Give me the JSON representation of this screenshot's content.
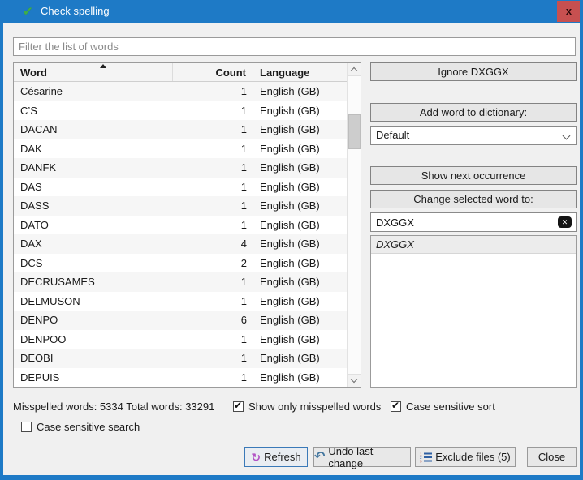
{
  "window": {
    "title": "Check spelling",
    "close_label": "x"
  },
  "filter": {
    "placeholder": "Filter the list of words"
  },
  "table": {
    "columns": {
      "word": "Word",
      "count": "Count",
      "language": "Language"
    },
    "rows": [
      {
        "word": "Césarine",
        "count": 1,
        "language": "English (GB)"
      },
      {
        "word": "C’S",
        "count": 1,
        "language": "English (GB)"
      },
      {
        "word": "DACAN",
        "count": 1,
        "language": "English (GB)"
      },
      {
        "word": "DAK",
        "count": 1,
        "language": "English (GB)"
      },
      {
        "word": "DANFK",
        "count": 1,
        "language": "English (GB)"
      },
      {
        "word": "DAS",
        "count": 1,
        "language": "English (GB)"
      },
      {
        "word": "DASS",
        "count": 1,
        "language": "English (GB)"
      },
      {
        "word": "DATO",
        "count": 1,
        "language": "English (GB)"
      },
      {
        "word": "DAX",
        "count": 4,
        "language": "English (GB)"
      },
      {
        "word": "DCS",
        "count": 2,
        "language": "English (GB)"
      },
      {
        "word": "DECRUSAMES",
        "count": 1,
        "language": "English (GB)"
      },
      {
        "word": "DELMUSON",
        "count": 1,
        "language": "English (GB)"
      },
      {
        "word": "DENPO",
        "count": 6,
        "language": "English (GB)"
      },
      {
        "word": "DENPOO",
        "count": 1,
        "language": "English (GB)"
      },
      {
        "word": "DEOBI",
        "count": 1,
        "language": "English (GB)"
      },
      {
        "word": "DEPUIS",
        "count": 1,
        "language": "English (GB)"
      }
    ]
  },
  "right_panel": {
    "ignore_button": "Ignore DXGGX",
    "add_word_button": "Add word to dictionary:",
    "dictionary_value": "Default",
    "show_next_button": "Show next occurrence",
    "change_word_button": "Change selected word to:",
    "change_word_value": "DXGGX",
    "suggestions": [
      "DXGGX"
    ]
  },
  "status": {
    "summary": "Misspelled words: 5334 Total words: 33291",
    "show_only_misspelled": {
      "label": "Show only misspelled words",
      "checked": true
    },
    "case_sensitive_sort": {
      "label": "Case sensitive sort",
      "checked": true
    },
    "case_sensitive_search": {
      "label": "Case sensitive search",
      "checked": false
    }
  },
  "footer": {
    "refresh": "Refresh",
    "undo": "Undo last change",
    "exclude": "Exclude files (5)",
    "close": "Close",
    "refresh_glyph": "↻",
    "undo_glyph": "↶"
  },
  "colors": {
    "titlebar": "#1e7ac6",
    "close_button": "#c75050",
    "check_icon": "#3fae49",
    "refresh_icon": "#b254c4",
    "undo_icon": "#44779f",
    "exclude_icon": "#2e5fa3",
    "focus_border": "#3a79b8"
  }
}
